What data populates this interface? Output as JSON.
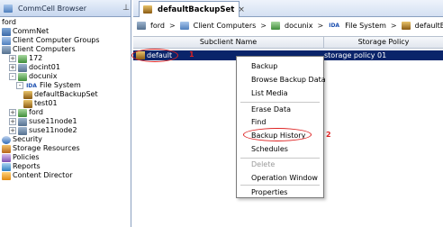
{
  "left_panel": {
    "title": "CommCell Browser",
    "tree": [
      {
        "label": "ford",
        "depth": 0,
        "expander": "",
        "icon": "none"
      },
      {
        "label": "CommNet",
        "depth": 0,
        "expander": "",
        "icon": "commnet-icon"
      },
      {
        "label": "Client Computer Groups",
        "depth": 0,
        "expander": "",
        "icon": "client-groups-icon"
      },
      {
        "label": "Client Computers",
        "depth": 0,
        "expander": "",
        "icon": "client-computers-icon"
      },
      {
        "label": "172",
        "depth": 1,
        "expander": "+",
        "icon": "client-icon"
      },
      {
        "label": "docint01",
        "depth": 1,
        "expander": "+",
        "icon": "computer-icon"
      },
      {
        "label": "docunix",
        "depth": 1,
        "expander": "-",
        "icon": "client-icon"
      },
      {
        "label": "File System",
        "depth": 2,
        "expander": "-",
        "icon": "file-system-icon"
      },
      {
        "label": "defaultBackupSet",
        "depth": 3,
        "expander": "",
        "icon": "backupset-icon"
      },
      {
        "label": "test01",
        "depth": 3,
        "expander": "",
        "icon": "backupset-icon"
      },
      {
        "label": "ford",
        "depth": 1,
        "expander": "+",
        "icon": "client-icon"
      },
      {
        "label": "suse11node1",
        "depth": 1,
        "expander": "+",
        "icon": "computer-icon"
      },
      {
        "label": "suse11node2",
        "depth": 1,
        "expander": "+",
        "icon": "computer-icon"
      },
      {
        "label": "Security",
        "depth": 0,
        "expander": "",
        "icon": "security-icon"
      },
      {
        "label": "Storage Resources",
        "depth": 0,
        "expander": "",
        "icon": "storage-icon"
      },
      {
        "label": "Policies",
        "depth": 0,
        "expander": "",
        "icon": "policies-icon"
      },
      {
        "label": "Reports",
        "depth": 0,
        "expander": "",
        "icon": "reports-icon"
      },
      {
        "label": "Content Director",
        "depth": 0,
        "expander": "",
        "icon": "content-director-icon"
      }
    ]
  },
  "tab": {
    "label": "defaultBackupSet",
    "close": "×"
  },
  "breadcrumb": [
    "ford",
    "Client Computers",
    "docunix",
    "File System",
    "defaultBackupSet"
  ],
  "breadcrumb_fs_tag": "IDA",
  "table": {
    "columns": [
      "Subclient Name",
      "Storage Policy"
    ],
    "rows": [
      {
        "name": "default",
        "storage_policy": "storage policy 01"
      }
    ]
  },
  "callouts": {
    "one": "1",
    "two": "2"
  },
  "context_menu": {
    "groups": [
      [
        "Backup",
        "Browse Backup Data",
        "List Media"
      ],
      [
        "Erase Data",
        "Find",
        "Backup History",
        "Schedules"
      ],
      [
        "Delete",
        "Operation Window"
      ],
      [
        "Properties"
      ]
    ],
    "disabled": [
      "Delete"
    ],
    "highlighted": "Backup History"
  },
  "colors": {
    "selection": "#0a246a",
    "callout": "#d22222",
    "header_gradient": "#c6d6ee"
  }
}
